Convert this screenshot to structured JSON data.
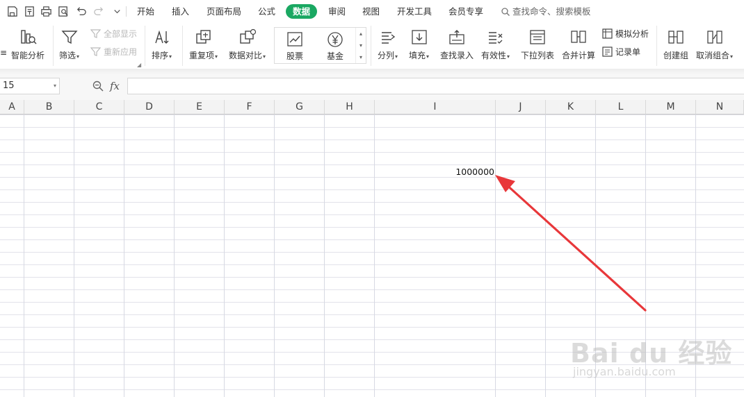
{
  "menu": {
    "tabs": [
      "开始",
      "插入",
      "页面布局",
      "公式",
      "数据",
      "审阅",
      "视图",
      "开发工具",
      "会员专享"
    ],
    "active_tab": "数据",
    "search_placeholder": "查找命令、搜索模板"
  },
  "ribbon": {
    "smart_analysis": "智能分析",
    "filter": "筛选",
    "show_all": "全部显示",
    "reapply": "重新应用",
    "sort": "排序",
    "duplicates": "重复项",
    "compare": "数据对比",
    "stocks": "股票",
    "funds": "基金",
    "split_column": "分列",
    "fill": "填充",
    "lookup_entry": "查找录入",
    "validity": "有效性",
    "dropdown_list": "下拉列表",
    "consolidate": "合并计算",
    "what_if": "模拟分析",
    "record_sheet": "记录单",
    "create_group": "创建组",
    "ungroup": "取消组合"
  },
  "formula_bar": {
    "name_box": "15",
    "fx_label": "fx",
    "formula": ""
  },
  "grid": {
    "columns": [
      "A",
      "B",
      "C",
      "D",
      "E",
      "F",
      "G",
      "H",
      "I",
      "J",
      "K",
      "L",
      "M",
      "N"
    ],
    "cell_value": "1000000"
  },
  "watermark": {
    "main": "Bai du 经验",
    "sub": "jingyan.baidu.com"
  },
  "colors": {
    "active_tab": "#1aa862",
    "arrow": "#e8373a"
  }
}
